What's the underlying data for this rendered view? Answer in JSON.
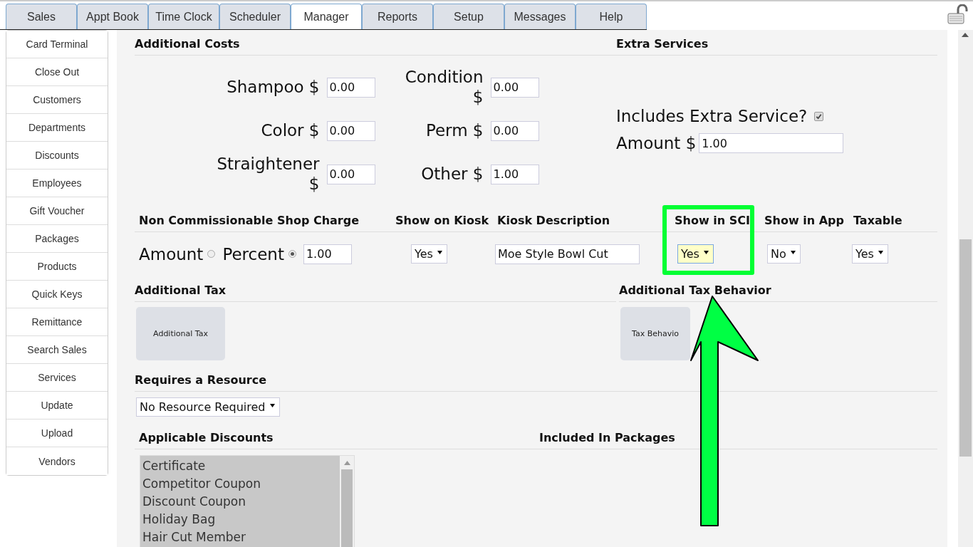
{
  "tabs": [
    {
      "label": "Sales",
      "selected": false
    },
    {
      "label": "Appt Book",
      "selected": false
    },
    {
      "label": "Time Clock",
      "selected": false
    },
    {
      "label": "Scheduler",
      "selected": false
    },
    {
      "label": "Manager",
      "selected": true
    },
    {
      "label": "Reports",
      "selected": false
    },
    {
      "label": "Setup",
      "selected": false
    },
    {
      "label": "Messages",
      "selected": false
    },
    {
      "label": "Help",
      "selected": false
    }
  ],
  "sidebar": {
    "items": [
      "Card Terminal",
      "Close Out",
      "Customers",
      "Departments",
      "Discounts",
      "Employees",
      "Gift Voucher",
      "Packages",
      "Products",
      "Quick Keys",
      "Remittance",
      "Search Sales",
      "Services",
      "Update",
      "Upload",
      "Vendors"
    ]
  },
  "additional_costs": {
    "title": "Additional Costs",
    "rows": [
      {
        "fields": [
          {
            "label": "Shampoo $",
            "value": "0.00"
          },
          {
            "label": "Condition $",
            "value": "0.00"
          }
        ]
      },
      {
        "fields": [
          {
            "label": "Color $",
            "value": "0.00"
          },
          {
            "label": "Perm $",
            "value": "0.00"
          }
        ]
      },
      {
        "fields": [
          {
            "label": "Straightener $",
            "value": "0.00"
          },
          {
            "label": "Other $",
            "value": "1.00"
          }
        ]
      }
    ]
  },
  "extra_services": {
    "title": "Extra Services",
    "includes_label": "Includes Extra Service?",
    "includes_checked": true,
    "amount_label": "Amount $",
    "amount_value": "1.00"
  },
  "shop_charge": {
    "columns": [
      "Non Commissionable Shop Charge",
      "Show on Kiosk",
      "Kiosk Description",
      "Show in SCI",
      "Show in App",
      "Taxable"
    ],
    "charge_types": [
      {
        "label": "Amount",
        "selected": false
      },
      {
        "label": "Percent",
        "selected": true
      }
    ],
    "charge_value": "1.00",
    "show_on_kiosk": {
      "value": "Yes",
      "focused": false
    },
    "kiosk_description": "Moe Style Bowl Cut",
    "show_in_sci": {
      "value": "Yes",
      "focused": true
    },
    "show_in_app": {
      "value": "No",
      "focused": false
    },
    "taxable": {
      "value": "Yes",
      "focused": false
    }
  },
  "additional_tax": {
    "title": "Additional Tax",
    "button": "Additional Tax"
  },
  "tax_behavior": {
    "title": "Additional Tax Behavior",
    "button": "Tax Behavio"
  },
  "resource": {
    "title": "Requires a Resource",
    "value": "No Resource Required"
  },
  "discounts": {
    "title": "Applicable Discounts",
    "items": [
      {
        "label": "Certificate",
        "selected": true
      },
      {
        "label": "Competitor Coupon",
        "selected": true
      },
      {
        "label": "Discount Coupon",
        "selected": true
      },
      {
        "label": "Holiday Bag",
        "selected": true
      },
      {
        "label": "Hair Cut Member",
        "selected": true
      }
    ]
  },
  "packages": {
    "title": "Included In Packages"
  },
  "callout": {
    "kind": "box-and-arrow"
  }
}
